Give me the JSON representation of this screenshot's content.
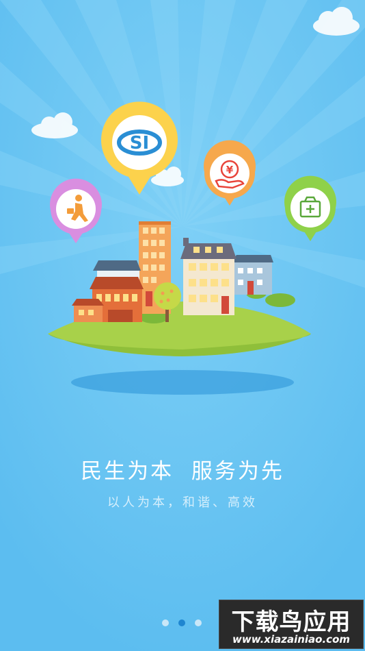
{
  "splash": {
    "title": "民生为本  服务为先",
    "subtitle": "以人为本，和谐、高效",
    "page_indicator": {
      "total": 3,
      "active_index": 1
    }
  },
  "icons": [
    "social-security-si-icon",
    "job-seeker-icon",
    "money-hand-icon",
    "medical-kit-icon"
  ],
  "colors": {
    "background": "#5cbdf0",
    "active_dot": "#1f86d0",
    "inactive_dot": "#c9e7f8"
  },
  "watermark": {
    "title": "下载鸟应用",
    "url": "www.xiazainiao.com"
  }
}
